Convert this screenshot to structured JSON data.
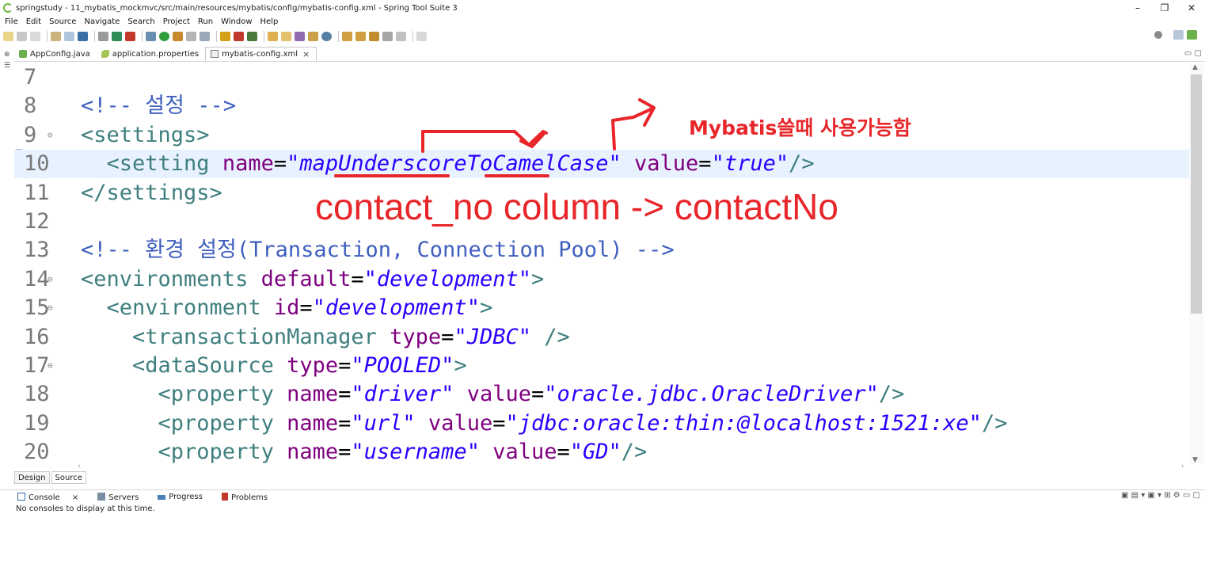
{
  "window": {
    "title": "springstudy - 11_mybatis_mockmvc/src/main/resources/mybatis/config/mybatis-config.xml - Spring Tool Suite 3",
    "controls": [
      "–",
      "❐",
      "✕"
    ]
  },
  "menu": [
    "File",
    "Edit",
    "Source",
    "Navigate",
    "Search",
    "Project",
    "Run",
    "Window",
    "Help"
  ],
  "editor_tabs": [
    {
      "label": "AppConfig.java",
      "icon": "java-file-icon"
    },
    {
      "label": "application.properties",
      "icon": "properties-file-icon"
    },
    {
      "label": "mybatis-config.xml",
      "icon": "xml-file-icon",
      "active": true,
      "close": "×"
    }
  ],
  "code_lines": [
    {
      "n": "7",
      "fold": "",
      "parts": []
    },
    {
      "n": "8",
      "fold": "",
      "parts": [
        {
          "t": "<!-- 설정 -->",
          "c": "c-comment"
        }
      ]
    },
    {
      "n": "9",
      "fold": "⊖",
      "parts": [
        {
          "t": "<settings>",
          "c": "c-tag"
        }
      ]
    },
    {
      "n": "10",
      "fold": "",
      "current": true,
      "parts": [
        {
          "t": "  <setting ",
          "c": "c-tag"
        },
        {
          "t": "name",
          "c": "c-attr"
        },
        {
          "t": "=",
          "c": "c-punct"
        },
        {
          "t": "\"mapUnderscoreToCamelCase\"",
          "c": "c-val"
        },
        {
          "t": " value",
          "c": "c-attr"
        },
        {
          "t": "=",
          "c": "c-punct"
        },
        {
          "t": "\"true\"",
          "c": "c-val"
        },
        {
          "t": "/>",
          "c": "c-tag"
        }
      ]
    },
    {
      "n": "11",
      "fold": "",
      "parts": [
        {
          "t": "</settings>",
          "c": "c-tag"
        }
      ]
    },
    {
      "n": "12",
      "fold": "",
      "parts": []
    },
    {
      "n": "13",
      "fold": "",
      "parts": [
        {
          "t": "<!-- 환경 설정(Transaction, Connection Pool) -->",
          "c": "c-comment"
        }
      ]
    },
    {
      "n": "14",
      "fold": "⊖",
      "parts": [
        {
          "t": "<environments ",
          "c": "c-tag"
        },
        {
          "t": "default",
          "c": "c-attr"
        },
        {
          "t": "=",
          "c": "c-punct"
        },
        {
          "t": "\"development\"",
          "c": "c-val"
        },
        {
          "t": ">",
          "c": "c-tag"
        }
      ]
    },
    {
      "n": "15",
      "fold": "⊖",
      "parts": [
        {
          "t": "  <environment ",
          "c": "c-tag"
        },
        {
          "t": "id",
          "c": "c-attr"
        },
        {
          "t": "=",
          "c": "c-punct"
        },
        {
          "t": "\"development\"",
          "c": "c-val"
        },
        {
          "t": ">",
          "c": "c-tag"
        }
      ]
    },
    {
      "n": "16",
      "fold": "",
      "parts": [
        {
          "t": "    <transactionManager ",
          "c": "c-tag"
        },
        {
          "t": "type",
          "c": "c-attr"
        },
        {
          "t": "=",
          "c": "c-punct"
        },
        {
          "t": "\"JDBC\"",
          "c": "c-val"
        },
        {
          "t": " />",
          "c": "c-tag"
        }
      ]
    },
    {
      "n": "17",
      "fold": "⊖",
      "parts": [
        {
          "t": "    <dataSource ",
          "c": "c-tag"
        },
        {
          "t": "type",
          "c": "c-attr"
        },
        {
          "t": "=",
          "c": "c-punct"
        },
        {
          "t": "\"POOLED\"",
          "c": "c-val"
        },
        {
          "t": ">",
          "c": "c-tag"
        }
      ]
    },
    {
      "n": "18",
      "fold": "",
      "parts": [
        {
          "t": "      <property ",
          "c": "c-tag"
        },
        {
          "t": "name",
          "c": "c-attr"
        },
        {
          "t": "=",
          "c": "c-punct"
        },
        {
          "t": "\"driver\"",
          "c": "c-val"
        },
        {
          "t": " value",
          "c": "c-attr"
        },
        {
          "t": "=",
          "c": "c-punct"
        },
        {
          "t": "\"oracle.jdbc.OracleDriver\"",
          "c": "c-val"
        },
        {
          "t": "/>",
          "c": "c-tag"
        }
      ]
    },
    {
      "n": "19",
      "fold": "",
      "parts": [
        {
          "t": "      <property ",
          "c": "c-tag"
        },
        {
          "t": "name",
          "c": "c-attr"
        },
        {
          "t": "=",
          "c": "c-punct"
        },
        {
          "t": "\"url\"",
          "c": "c-val"
        },
        {
          "t": " value",
          "c": "c-attr"
        },
        {
          "t": "=",
          "c": "c-punct"
        },
        {
          "t": "\"jdbc:oracle:thin:@localhost:1521:xe\"",
          "c": "c-val"
        },
        {
          "t": "/>",
          "c": "c-tag"
        }
      ]
    },
    {
      "n": "20",
      "fold": "",
      "parts": [
        {
          "t": "      <property ",
          "c": "c-tag"
        },
        {
          "t": "name",
          "c": "c-attr"
        },
        {
          "t": "=",
          "c": "c-punct"
        },
        {
          "t": "\"username\"",
          "c": "c-val"
        },
        {
          "t": " value",
          "c": "c-attr"
        },
        {
          "t": "=",
          "c": "c-punct"
        },
        {
          "t": "\"GD\"",
          "c": "c-val"
        },
        {
          "t": "/>",
          "c": "c-tag"
        }
      ]
    }
  ],
  "annotations": {
    "note_korean": "Mybatis쓸때 사용가능함",
    "note_mapping": "contact_no column -> contactNo",
    "color": "#e8262a"
  },
  "bottom_tabs": [
    "Design",
    "Source"
  ],
  "console": {
    "tabs": [
      "Console",
      "Servers",
      "Progress",
      "Problems"
    ],
    "console_close": "×",
    "message": "No consoles to display at this time."
  },
  "colors": {
    "comment": "#3f5fbf",
    "tag": "#3f7f7f",
    "attribute": "#7f007f",
    "value": "#2a00ff",
    "current_line": "#e8f2fe"
  }
}
